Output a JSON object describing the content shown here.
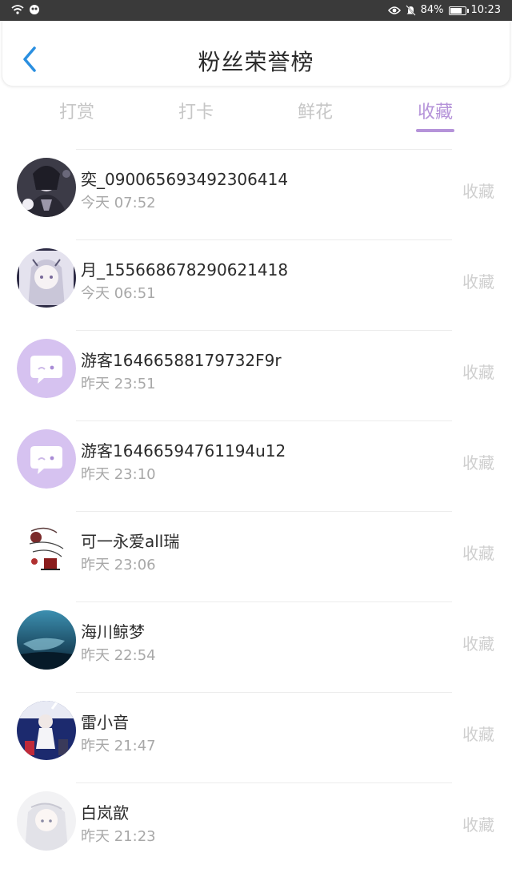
{
  "status_bar": {
    "battery": "84%",
    "battery_level": 0.84,
    "time": "10:23"
  },
  "header": {
    "title": "粉丝荣誉榜"
  },
  "tabs": [
    {
      "label": "打赏",
      "active": false
    },
    {
      "label": "打卡",
      "active": false
    },
    {
      "label": "鲜花",
      "active": false
    },
    {
      "label": "收藏",
      "active": true
    }
  ],
  "colors": {
    "accent": "#b593d9",
    "guest_avatar_bg": "#d6c2f0"
  },
  "fans": [
    {
      "name": "奕_090065693492306414",
      "time": "今天 07:52",
      "action": "收藏",
      "avatar": "dark-anime-avatar"
    },
    {
      "name": "月_155668678290621418",
      "time": "今天 06:51",
      "action": "收藏",
      "avatar": "pale-anime-avatar"
    },
    {
      "name": "游客16466588179732F9r",
      "time": "昨天 23:51",
      "action": "收藏",
      "avatar": "guest-chat-icon"
    },
    {
      "name": "游客16466594761194u12",
      "time": "昨天 23:10",
      "action": "收藏",
      "avatar": "guest-chat-icon"
    },
    {
      "name": "可一永爱all瑞",
      "time": "昨天 23:06",
      "action": "收藏",
      "avatar": "red-sketch-avatar"
    },
    {
      "name": "海川鲸梦",
      "time": "昨天 22:54",
      "action": "收藏",
      "avatar": "ocean-whale-avatar"
    },
    {
      "name": "雷小音",
      "time": "昨天 21:47",
      "action": "收藏",
      "avatar": "concert-anime-avatar"
    },
    {
      "name": "白岚歆",
      "time": "昨天 21:23",
      "action": "收藏",
      "avatar": "white-hair-anime-avatar"
    }
  ]
}
